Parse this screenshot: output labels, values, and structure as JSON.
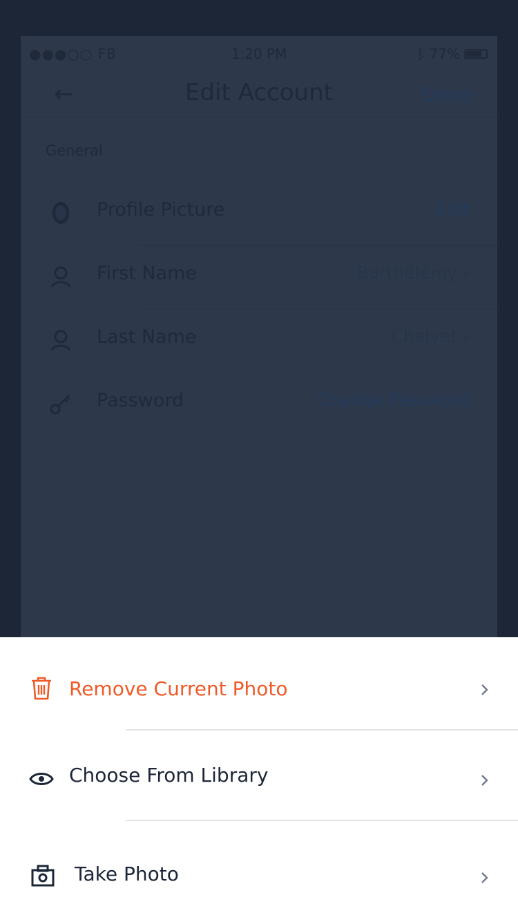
{
  "status_bar": {
    "carrier": "●●●○○ FB",
    "time": "1:20 PM",
    "battery": "77%"
  },
  "nav": {
    "title": "Edit Account",
    "done_label": "Done"
  },
  "section": {
    "label": "General"
  },
  "rows": [
    {
      "label": "Profile Picture",
      "value": "Edit"
    },
    {
      "label": "First Name",
      "value": "Barthélémy"
    },
    {
      "label": "Last Name",
      "value": "Chalvet"
    },
    {
      "label": "Password",
      "value": "Change Password"
    }
  ],
  "action_sheet": {
    "items": [
      {
        "label": "Remove Current Photo",
        "icon": "trash-icon"
      },
      {
        "label": "Choose From Library",
        "icon": "eye-icon"
      },
      {
        "label": "Take Photo",
        "icon": "camera-icon"
      }
    ]
  },
  "colors": {
    "destructive": "#f05a28",
    "overlay": "#1c2637",
    "text": "#1c2637",
    "chevron": "#6e7a8c"
  }
}
